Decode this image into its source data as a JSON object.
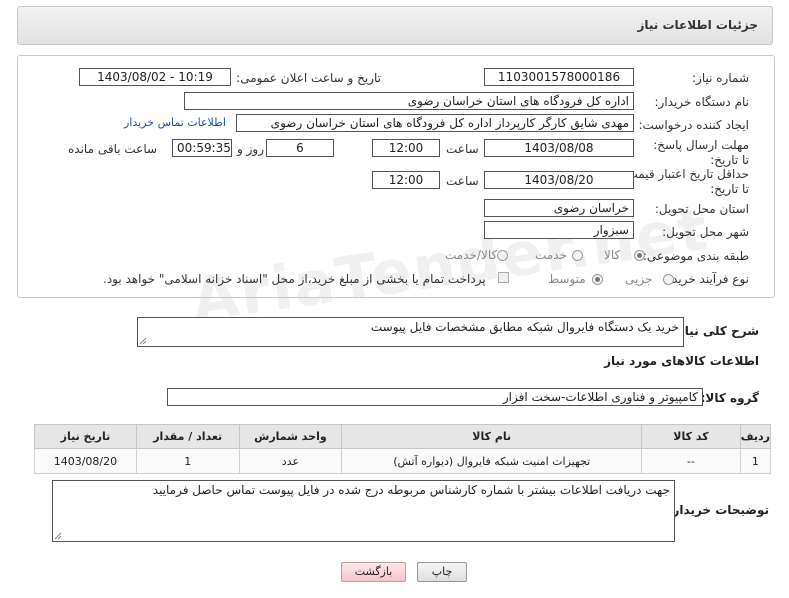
{
  "header": {
    "title": "جزئیات اطلاعات نیاز"
  },
  "watermark": "AriaTender.net",
  "form": {
    "need_number_label": "شماره نیاز:",
    "need_number": "1103001578000186",
    "announce_label": "تاریخ و ساعت اعلان عمومی:",
    "announce_value": "1403/08/02 - 10:19",
    "buyer_label": "نام دستگاه خریدار:",
    "buyer_value": "اداره کل فرودگاه های استان خراسان رضوی",
    "creator_label": "ایجاد کننده درخواست:",
    "creator_value": "مهدی شایق کارگر کارپرداز اداره کل فرودگاه های استان خراسان رضوی",
    "contact_link": "اطلاعات تماس خریدار",
    "deadline_label": "مهلت ارسال پاسخ: تا تاریخ:",
    "deadline_date": "1403/08/08",
    "time_label": "ساعت",
    "deadline_time": "12:00",
    "days_value": "6",
    "days_label": "روز و",
    "remaining_time": "00:59:35",
    "remaining_label": "ساعت باقی مانده",
    "validity_label": "حداقل تاریخ اعتبار قیمت: تا تاریخ:",
    "validity_date": "1403/08/20",
    "validity_time": "12:00",
    "province_label": "استان محل تحویل:",
    "province_value": "خراسان رضوی",
    "city_label": "شهر محل تحویل:",
    "city_value": "سبزوار",
    "category_label": "طبقه بندی موضوعی:",
    "category_options": [
      "کالا",
      "خدمت",
      "کالا/خدمت"
    ],
    "category_selected": "کالا",
    "process_label": "نوع فرآیند خرید :",
    "process_options": [
      "جزیی",
      "متوسط"
    ],
    "process_selected": "متوسط",
    "payment_note": "پرداخت تمام یا بخشی از مبلغ خرید،از محل \"اسناد خزانه اسلامی\" خواهد بود."
  },
  "description": {
    "label": "شرح کلی نیاز:",
    "value": "خرید یک دستگاه فایروال شبکه مطابق مشخصات فایل پیوست"
  },
  "goods_section": {
    "title": "اطلاعات کالاهای مورد نیاز",
    "group_label": "گروه کالا:",
    "group_value": "کامپیوتر و فناوری اطلاعات-سخت افزار"
  },
  "table": {
    "headers": [
      "ردیف",
      "کد کالا",
      "نام کالا",
      "واحد شمارش",
      "تعداد / مقدار",
      "تاریخ نیاز"
    ],
    "rows": [
      [
        "1",
        "--",
        "تجهیزات امنیت شبکه فایروال (دیواره آتش)",
        "عدد",
        "1",
        "1403/08/20"
      ]
    ]
  },
  "buyer_notes": {
    "label": "توضیحات خریدار:",
    "value": "جهت دریافت اطلاعات بیشتر با شماره کارشناس مربوطه درج شده در فایل پیوست تماس حاصل فرمایید"
  },
  "buttons": {
    "print": "چاپ",
    "back": "بازگشت"
  }
}
